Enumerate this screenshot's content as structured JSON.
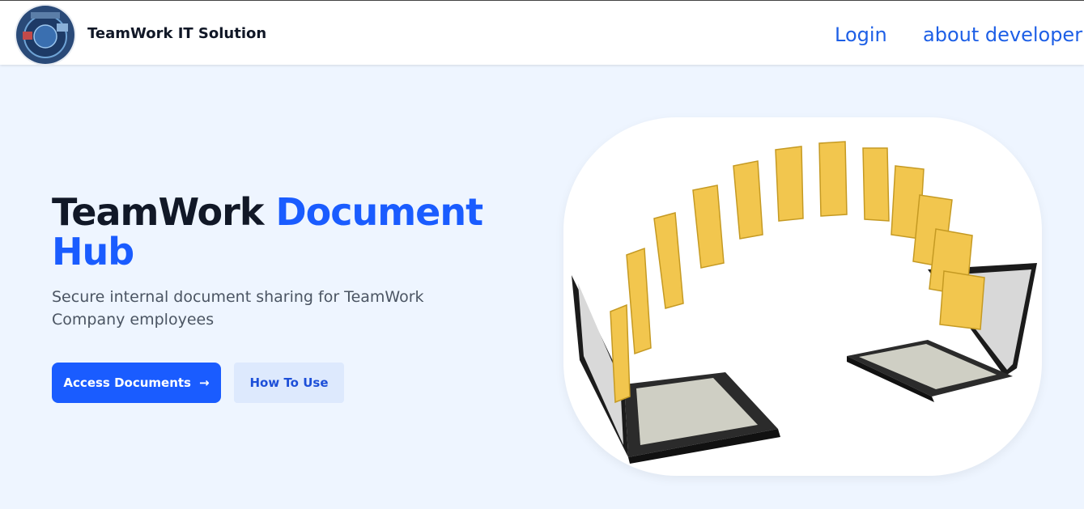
{
  "navbar": {
    "brand": "TeamWork IT Solution",
    "links": [
      {
        "label": "Login"
      },
      {
        "label": "about developer"
      }
    ]
  },
  "hero": {
    "title_part1": "TeamWork ",
    "title_accent": "Document Hub",
    "subtitle": "Secure internal document sharing for TeamWork Company employees",
    "primary_button": "Access Documents",
    "primary_icon": "arrow-right-icon",
    "secondary_button": "How To Use",
    "image": "folders-transfer-between-laptops"
  },
  "colors": {
    "accent": "#1a5cff",
    "page_background": "#eef5ff",
    "link": "#1d5fe6"
  }
}
